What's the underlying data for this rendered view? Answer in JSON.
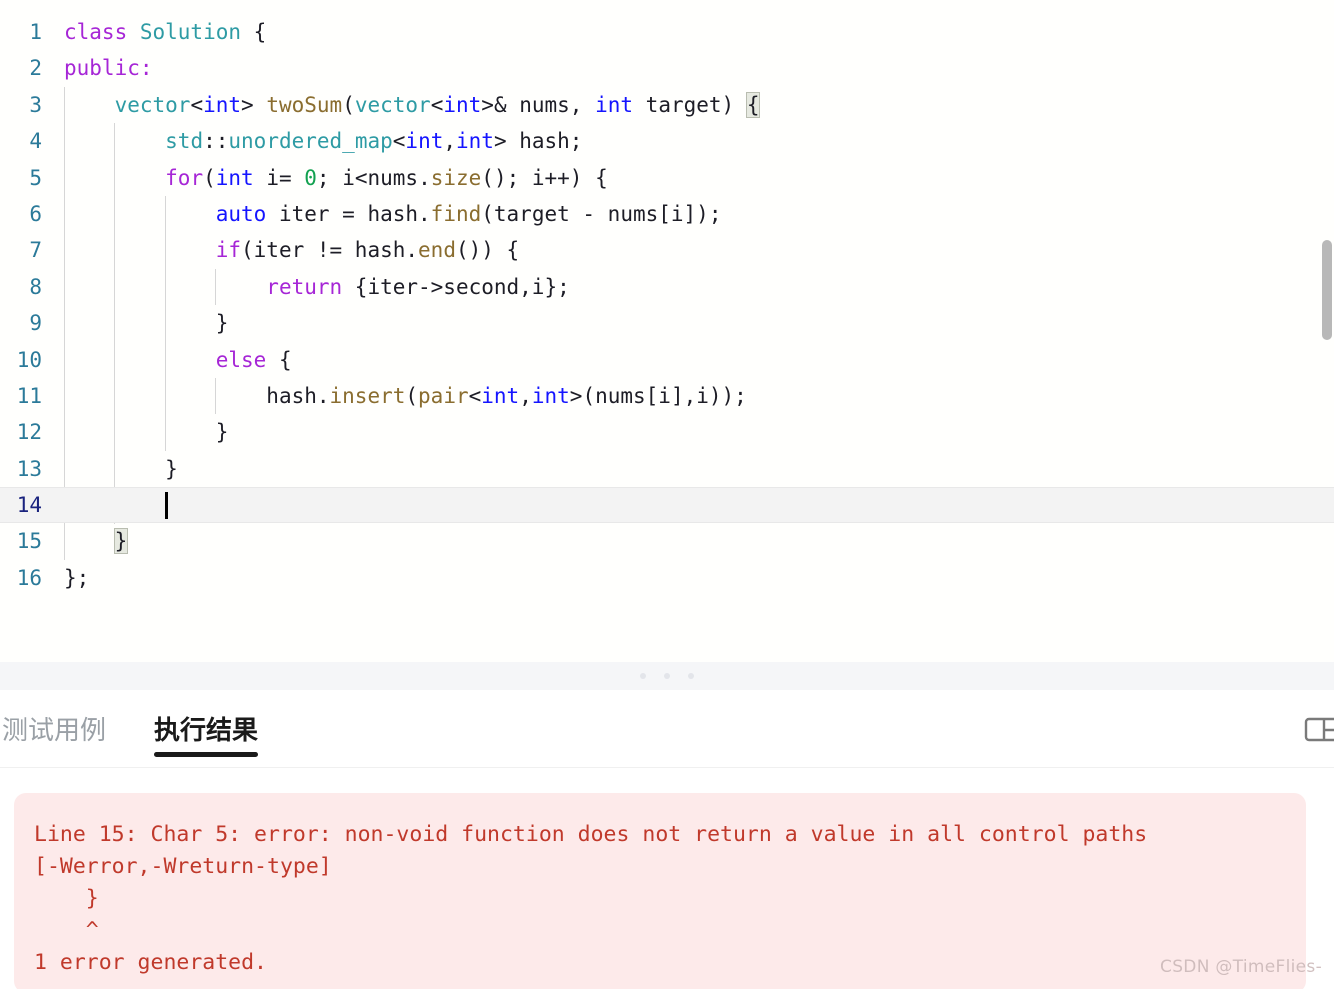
{
  "editor": {
    "name": "code-editor",
    "language": "cpp",
    "cursor_line": 14,
    "active_line": 14,
    "lines": [
      {
        "num": "1",
        "indent": 0,
        "tokens": [
          {
            "t": "class ",
            "c": "kw"
          },
          {
            "t": "Solution",
            "c": "type"
          },
          {
            "t": " {",
            "c": "pl"
          }
        ]
      },
      {
        "num": "2",
        "indent": 0,
        "tokens": [
          {
            "t": "public:",
            "c": "kw"
          }
        ]
      },
      {
        "num": "3",
        "indent": 1,
        "tokens": [
          {
            "t": "vector",
            "c": "type"
          },
          {
            "t": "<",
            "c": "pl"
          },
          {
            "t": "int",
            "c": "bi"
          },
          {
            "t": "> ",
            "c": "pl"
          },
          {
            "t": "twoSum",
            "c": "fn"
          },
          {
            "t": "(",
            "c": "pl"
          },
          {
            "t": "vector",
            "c": "type"
          },
          {
            "t": "<",
            "c": "pl"
          },
          {
            "t": "int",
            "c": "bi"
          },
          {
            "t": ">& nums, ",
            "c": "pl"
          },
          {
            "t": "int",
            "c": "bi"
          },
          {
            "t": " target) ",
            "c": "pl"
          },
          {
            "t": "{",
            "c": "pl bracket-hl"
          }
        ]
      },
      {
        "num": "4",
        "indent": 2,
        "tokens": [
          {
            "t": "std",
            "c": "type"
          },
          {
            "t": "::",
            "c": "pl"
          },
          {
            "t": "unordered_map",
            "c": "type"
          },
          {
            "t": "<",
            "c": "pl"
          },
          {
            "t": "int",
            "c": "bi"
          },
          {
            "t": ",",
            "c": "pl"
          },
          {
            "t": "int",
            "c": "bi"
          },
          {
            "t": "> hash;",
            "c": "pl"
          }
        ]
      },
      {
        "num": "5",
        "indent": 2,
        "tokens": [
          {
            "t": "for",
            "c": "kw"
          },
          {
            "t": "(",
            "c": "pl"
          },
          {
            "t": "int",
            "c": "bi"
          },
          {
            "t": " i= ",
            "c": "pl"
          },
          {
            "t": "0",
            "c": "num"
          },
          {
            "t": "; i<nums.",
            "c": "pl"
          },
          {
            "t": "size",
            "c": "fn"
          },
          {
            "t": "(); i++) {",
            "c": "pl"
          }
        ]
      },
      {
        "num": "6",
        "indent": 3,
        "tokens": [
          {
            "t": "auto",
            "c": "bi"
          },
          {
            "t": " iter = hash.",
            "c": "pl"
          },
          {
            "t": "find",
            "c": "fn"
          },
          {
            "t": "(target - nums[i]);",
            "c": "pl"
          }
        ]
      },
      {
        "num": "7",
        "indent": 3,
        "tokens": [
          {
            "t": "if",
            "c": "kw"
          },
          {
            "t": "(iter != hash.",
            "c": "pl"
          },
          {
            "t": "end",
            "c": "fn"
          },
          {
            "t": "()) {",
            "c": "pl"
          }
        ]
      },
      {
        "num": "8",
        "indent": 4,
        "tokens": [
          {
            "t": "return",
            "c": "kw"
          },
          {
            "t": " {iter->second,i};",
            "c": "pl"
          }
        ]
      },
      {
        "num": "9",
        "indent": 3,
        "tokens": [
          {
            "t": "}",
            "c": "pl"
          }
        ]
      },
      {
        "num": "10",
        "indent": 3,
        "tokens": [
          {
            "t": "else",
            "c": "kw"
          },
          {
            "t": " {",
            "c": "pl"
          }
        ]
      },
      {
        "num": "11",
        "indent": 4,
        "tokens": [
          {
            "t": "hash.",
            "c": "pl"
          },
          {
            "t": "insert",
            "c": "fn"
          },
          {
            "t": "(",
            "c": "pl"
          },
          {
            "t": "pair",
            "c": "fn"
          },
          {
            "t": "<",
            "c": "pl"
          },
          {
            "t": "int",
            "c": "bi"
          },
          {
            "t": ",",
            "c": "pl"
          },
          {
            "t": "int",
            "c": "bi"
          },
          {
            "t": ">(nums[i],i));",
            "c": "pl"
          }
        ]
      },
      {
        "num": "12",
        "indent": 3,
        "tokens": [
          {
            "t": "}",
            "c": "pl"
          }
        ]
      },
      {
        "num": "13",
        "indent": 2,
        "tokens": [
          {
            "t": "}",
            "c": "pl"
          }
        ]
      },
      {
        "num": "14",
        "indent": 2,
        "tokens": [
          {
            "t": "",
            "c": "pl"
          }
        ]
      },
      {
        "num": "15",
        "indent": 1,
        "tokens": [
          {
            "t": "}",
            "c": "pl bracket-hl"
          }
        ]
      },
      {
        "num": "16",
        "indent": 0,
        "tokens": [
          {
            "t": "};",
            "c": "pl"
          }
        ]
      }
    ]
  },
  "divider": {
    "name": "panel-drag-handle",
    "dots": 3
  },
  "tabs": [
    {
      "label": "测试用例",
      "name": "tab-test-cases",
      "active": false
    },
    {
      "label": "执行结果",
      "name": "tab-execution-result",
      "active": true
    }
  ],
  "tab_actions": {
    "layout_icon": "panel-layout-icon"
  },
  "result": {
    "status": "error",
    "error_text": "Line 15: Char 5: error: non-void function does not return a value in all control paths\n[-Werror,-Wreturn-type]\n    }\n    ^\n1 error generated.",
    "background_color": "#fdeaea",
    "text_color": "#c0392b"
  },
  "watermark": {
    "text": "CSDN @TimeFlies-"
  },
  "colors": {
    "editor_bg": "#fffffd",
    "gutter_number": "#2b7a99",
    "active_gutter_number": "#1a237e",
    "keyword": "#a626d6",
    "type": "#2e9ba4",
    "builtin": "#1515ff",
    "function": "#8a6d2f",
    "number": "#12a150",
    "plain": "#1d1d26",
    "active_line_bg": "#f3f3f3",
    "tab_active": "#1a1a1a",
    "tab_inactive": "#9aa0a6"
  }
}
